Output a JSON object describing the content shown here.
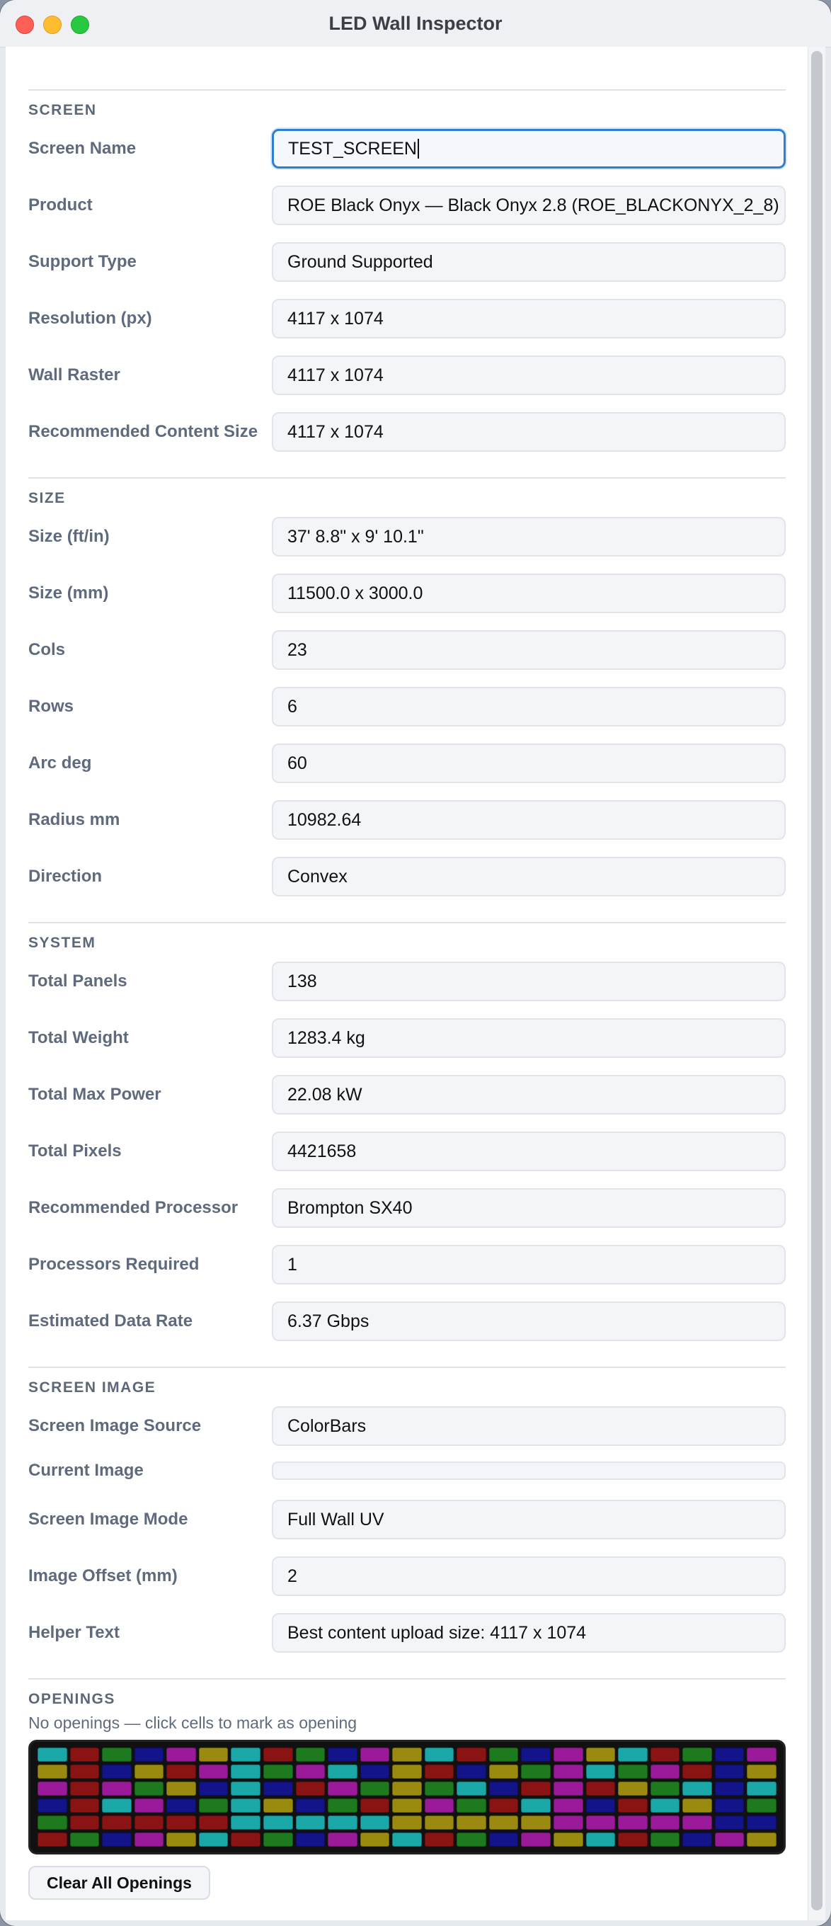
{
  "window": {
    "title": "LED Wall Inspector"
  },
  "sections": {
    "screen": {
      "title": "SCREEN",
      "rows": [
        {
          "label": "Screen Name",
          "value": "TEST_SCREEN"
        },
        {
          "label": "Product",
          "value": "ROE Black Onyx — Black Onyx 2.8 (ROE_BLACKONYX_2_8)"
        },
        {
          "label": "Support Type",
          "value": "Ground Supported"
        },
        {
          "label": "Resolution (px)",
          "value": "4117 x 1074"
        },
        {
          "label": "Wall Raster",
          "value": "4117 x 1074"
        },
        {
          "label": "Recommended Content Size",
          "value": "4117 x 1074"
        }
      ]
    },
    "size": {
      "title": "SIZE",
      "rows": [
        {
          "label": "Size (ft/in)",
          "value": "37' 8.8\" x 9' 10.1\""
        },
        {
          "label": "Size (mm)",
          "value": "11500.0 x 3000.0"
        },
        {
          "label": "Cols",
          "value": "23"
        },
        {
          "label": "Rows",
          "value": "6"
        },
        {
          "label": "Arc deg",
          "value": "60"
        },
        {
          "label": "Radius mm",
          "value": "10982.64"
        },
        {
          "label": "Direction",
          "value": "Convex"
        }
      ]
    },
    "system": {
      "title": "SYSTEM",
      "rows": [
        {
          "label": "Total Panels",
          "value": "138"
        },
        {
          "label": "Total Weight",
          "value": "1283.4 kg"
        },
        {
          "label": "Total Max Power",
          "value": "22.08 kW"
        },
        {
          "label": "Total Pixels",
          "value": "4421658"
        },
        {
          "label": "Recommended Processor",
          "value": "Brompton SX40"
        },
        {
          "label": "Processors Required",
          "value": "1"
        },
        {
          "label": "Estimated Data Rate",
          "value": "6.37 Gbps"
        }
      ]
    },
    "screen_image": {
      "title": "SCREEN IMAGE",
      "rows": [
        {
          "label": "Screen Image Source",
          "value": "ColorBars"
        },
        {
          "label": "Current Image",
          "value": ""
        },
        {
          "label": "Screen Image Mode",
          "value": "Full Wall UV"
        },
        {
          "label": "Image Offset (mm)",
          "value": "2"
        },
        {
          "label": "Helper Text",
          "value": "Best content upload size: 4117 x 1074"
        }
      ]
    },
    "openings": {
      "title": "OPENINGS",
      "hint": "No openings — click cells to mark as opening",
      "clear_label": "Clear All Openings",
      "palette": [
        "#1aa7a7",
        "#8a1414",
        "#1e7a1e",
        "#14148a",
        "#9a1a9a",
        "#9a8a10"
      ],
      "grid_cols": 23,
      "grid_rows": 6
    }
  }
}
